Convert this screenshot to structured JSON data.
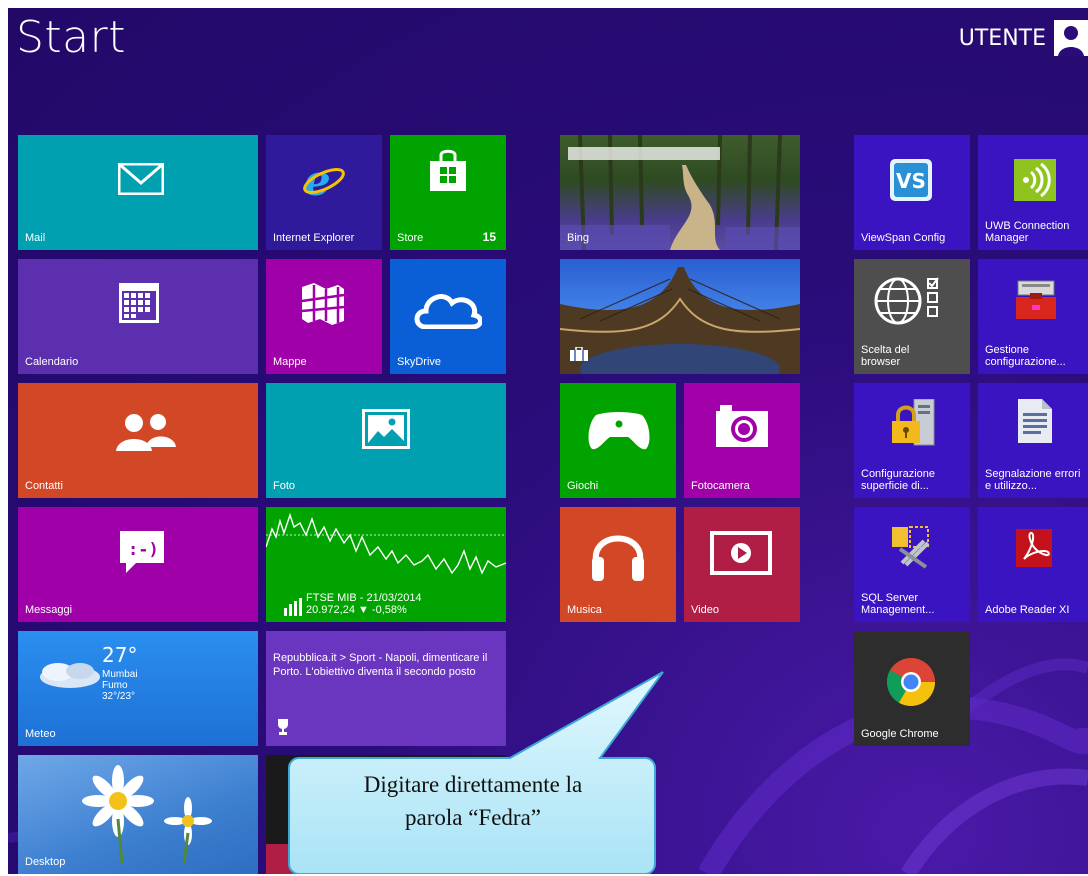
{
  "header": {
    "title": "Start",
    "user_name": "UTENTE"
  },
  "tiles": {
    "mail": "Mail",
    "internet_explorer": "Internet Explorer",
    "store": "Store",
    "store_badge": "15",
    "bing": "Bing",
    "viewspan": "ViewSpan Config",
    "uwb": "UWB Connection Manager",
    "calendario": "Calendario",
    "mappe": "Mappe",
    "skydrive": "SkyDrive",
    "scelta_browser": "Scelta del browser",
    "gestione": "Gestione configurazione...",
    "contatti": "Contatti",
    "foto": "Foto",
    "giochi": "Giochi",
    "fotocamera": "Fotocamera",
    "config_superficie": "Configurazione superficie di...",
    "segnalazione": "Segnalazione errori e utilizzo...",
    "messaggi": "Messaggi",
    "musica": "Musica",
    "video": "Video",
    "sql_server": "SQL Server Management...",
    "adobe": "Adobe Reader XI",
    "meteo": "Meteo",
    "google_chrome": "Google Chrome",
    "desktop": "Desktop"
  },
  "finance": {
    "line1": "FTSE MIB - 21/03/2014",
    "line2": "20.972,24 ▼ -0,58%"
  },
  "weather": {
    "temp": "27°",
    "city": "Mumbai",
    "condition": "Fumo",
    "range": "32°/23°"
  },
  "news": {
    "headline": "Repubblica.it > Sport - Napoli, dimenticare il Porto. L'obiettivo diventa il secondo posto"
  },
  "callout": {
    "line1": "Digitare direttamente la",
    "line2": "parola “Fedra”"
  },
  "colors": {
    "background": "#2a0c7a",
    "mail": "#00a0b1",
    "ie": "#2e1a9a",
    "store": "#00a300",
    "calendario": "#5b2fae",
    "mappe": "#9f00a7",
    "skydrive": "#0a5fd6",
    "contatti": "#d24726",
    "foto": "#00a0b1",
    "messaggi": "#9f00a7",
    "finance": "#00a300",
    "meteo": "#1e7fe0",
    "news": "#6a36c0",
    "giochi": "#00a300",
    "fotocamera": "#a200a8",
    "musica": "#d24726",
    "video": "#b01e45",
    "desktop_apps": "#3a14c0",
    "grey_tile": "#4e4e4e",
    "chrome_tile": "#2d2d2d",
    "callout_fill": "#c9f0fb"
  }
}
